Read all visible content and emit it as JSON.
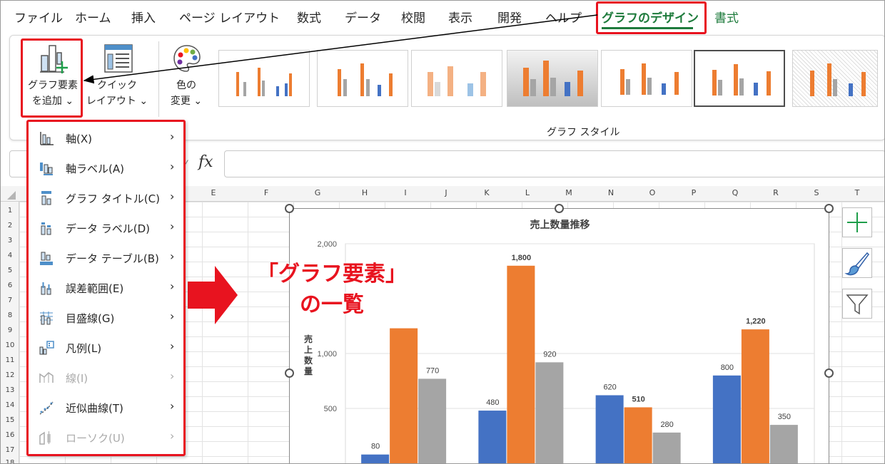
{
  "tabs": [
    "ファイル",
    "ホーム",
    "挿入",
    "ページ レイアウト",
    "数式",
    "データ",
    "校閲",
    "表示",
    "開発",
    "ヘルプ",
    "グラフのデザイン",
    "書式"
  ],
  "active_tab": "グラフのデザイン",
  "ribbon": {
    "add_element": {
      "line1": "グラフ要素",
      "line2": "を追加 ⌄"
    },
    "quick_layout": {
      "line1": "クイック",
      "line2": "レイアウト ⌄"
    },
    "change_color": {
      "line1": "色の",
      "line2": "変更 ⌄"
    },
    "styles_group_label": "グラフ スタイル"
  },
  "formula_bar": {
    "fx": "fx"
  },
  "columns": [
    "E",
    "F",
    "G",
    "H",
    "I",
    "J",
    "K",
    "L",
    "M",
    "N",
    "O",
    "P",
    "Q",
    "R",
    "S",
    "T"
  ],
  "rows": [
    "1",
    "2",
    "3",
    "4",
    "5",
    "6",
    "7",
    "8",
    "9",
    "10",
    "11",
    "12",
    "13",
    "14",
    "15",
    "16",
    "17",
    "18"
  ],
  "dropdown": [
    {
      "label": "軸(X)",
      "icon": "axes-icon",
      "disabled": false
    },
    {
      "label": "軸ラベル(A)",
      "icon": "axis-titles-icon",
      "disabled": false
    },
    {
      "label": "グラフ タイトル(C)",
      "icon": "chart-title-icon",
      "disabled": false
    },
    {
      "label": "データ ラベル(D)",
      "icon": "data-labels-icon",
      "disabled": false
    },
    {
      "label": "データ テーブル(B)",
      "icon": "data-table-icon",
      "disabled": false
    },
    {
      "label": "誤差範囲(E)",
      "icon": "error-bars-icon",
      "disabled": false
    },
    {
      "label": "目盛線(G)",
      "icon": "gridlines-icon",
      "disabled": false
    },
    {
      "label": "凡例(L)",
      "icon": "legend-icon",
      "disabled": false
    },
    {
      "label": "線(I)",
      "icon": "lines-icon",
      "disabled": true
    },
    {
      "label": "近似曲線(T)",
      "icon": "trendline-icon",
      "disabled": false
    },
    {
      "label": "ローソク(U)",
      "icon": "up-down-bars-icon",
      "disabled": true
    }
  ],
  "callout": {
    "line1": "「グラフ要素」",
    "line2": "の一覧"
  },
  "chart_data": {
    "type": "bar",
    "title": "売上数量推移",
    "ylabel": "売上数量",
    "ylim": [
      0,
      2000
    ],
    "yticks": [
      "500",
      "1,000",
      "2,000"
    ],
    "series": [
      {
        "values": [
          80,
          480,
          620,
          800
        ],
        "labels": [
          "80",
          "480",
          "620",
          "800"
        ],
        "color": "#4472c4"
      },
      {
        "values": [
          1230,
          1800,
          510,
          1220
        ],
        "labels": [
          "",
          "1,800",
          "510",
          "1,220"
        ],
        "color": "#ed7d31"
      },
      {
        "values": [
          770,
          920,
          280,
          350
        ],
        "labels": [
          "770",
          "920",
          "280",
          "350"
        ],
        "color": "#a5a5a5"
      }
    ]
  },
  "colors": {
    "accent_green": "#1e7b3c",
    "highlight_red": "#e8131f"
  }
}
